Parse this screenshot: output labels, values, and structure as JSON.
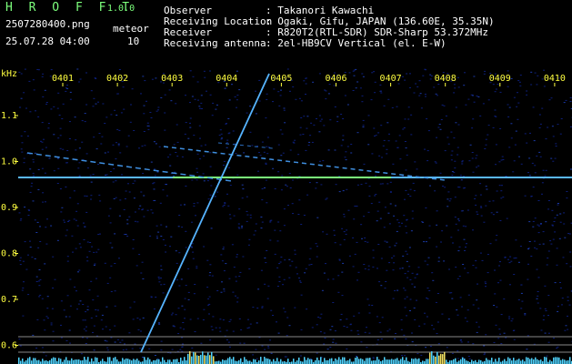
{
  "header": {
    "app_name": "H R O F F T",
    "version": "1.0.0",
    "filename": "2507280400.png",
    "datetime": "25.07.28 04:00",
    "meteor_label": "meteor",
    "meteor_count": "10",
    "observer_label": "Observer",
    "observer_value": ": Takanori Kawachi",
    "location_label": "Receiving Location",
    "location_value": ": Ogaki, Gifu, JAPAN (136.60E, 35.35N)",
    "receiver_label": "Receiver",
    "receiver_value": ": R820T2(RTL-SDR) SDR-Sharp 53.372MHz",
    "antenna_label": "Receiving antenna",
    "antenna_value": ": 2el-HB9CV Vertical (el. E-W)"
  },
  "axis": {
    "unit": "kHz",
    "time_ticks": [
      "0401",
      "0402",
      "0403",
      "0404",
      "0405",
      "0406",
      "0407",
      "0408",
      "0409",
      "0410"
    ],
    "freq_ticks": [
      "1.1",
      "1.0",
      "0.9",
      "0.8",
      "0.7",
      "0.6"
    ]
  },
  "colors": {
    "background": "#000000",
    "text_green": "#7CFF7C",
    "text_white": "#ffffff",
    "text_yellow": "#ffff40",
    "noise": "#0a1a6e",
    "signal": "#4fb0ff",
    "carrier": "#7cff7c"
  }
}
